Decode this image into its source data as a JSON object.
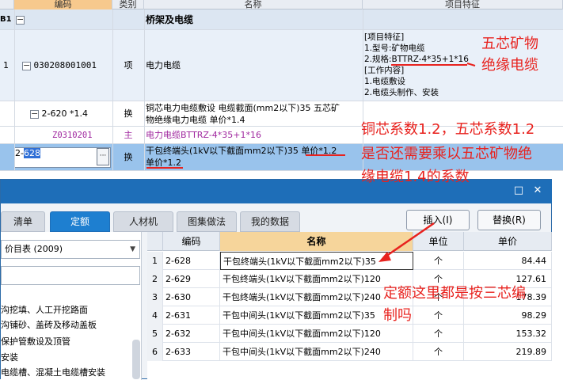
{
  "grid": {
    "headers": {
      "code": "编码",
      "type": "类别",
      "name": "名称",
      "feature": "项目特征"
    },
    "section": {
      "num": "B1",
      "toggle": "−",
      "name": "桥架及电缆"
    },
    "item": {
      "num": "1",
      "toggle": "−",
      "code": "030208001001",
      "type": "项",
      "name": "电力电缆",
      "features": [
        "[项目特征]",
        "1.型号:矿物电缆",
        "2.规格:BTTRZ-4*35+1*16",
        "[工作内容]",
        "1.电缆敷设",
        "2.电缆头制作、安装"
      ]
    },
    "sub": {
      "toggle": "−",
      "code": "2-620 *1.4",
      "type": "换",
      "name_line1": "铜芯电力电缆敷设 电缆截面(mm2以下)35  五芯矿",
      "name_line2": "物绝缘电力电缆 单价*1.4"
    },
    "main_material": {
      "code": "Z0310201",
      "type": "主",
      "name": "电力电缆BTTRZ-4*35+1*16"
    },
    "selected": {
      "code_prefix": "2-",
      "code_selected": "628",
      "more_button": "···",
      "type": "换",
      "name_line1": "干包终端头(1kV以下截面mm2以下)35  单价*1.2",
      "name_line2": "单价*1.2"
    }
  },
  "annotations": {
    "mineral_cable_line1": "五芯矿物",
    "mineral_cable_line2": "绝缘电缆",
    "question_line1": "铜芯系数1.2，五芯系数1.2",
    "question_line2": "是否还需要乘以五芯矿物绝",
    "question_line3": "缘电缆1.4的系数",
    "bottom_line1": "定额这里都是按三芯编",
    "bottom_line2": "制吗",
    "color": "#e8221e"
  },
  "dialog": {
    "title_buttons": {
      "maximize": "□",
      "close": "✕"
    },
    "tabs": [
      "清单",
      "定额",
      "人材机",
      "图集做法",
      "我的数据"
    ],
    "active_tab": "定额",
    "insert_button": "插入(I)",
    "replace_button": "替换(R)",
    "catalog_select": "价目表 (2009)",
    "tree_items": [
      "沟挖填、人工开挖路面",
      "沟铺砂、盖砖及移动盖板",
      "保护管敷设及顶管",
      "安装",
      "电缆槽、混凝土电缆槽安装"
    ],
    "table": {
      "columns": [
        "",
        "编码",
        "名称",
        "单位",
        "单价"
      ],
      "rows": [
        {
          "idx": "1",
          "code": "2-628",
          "name": "干包终端头(1kV以下截面mm2以下)35",
          "unit": "个",
          "price": "84.44"
        },
        {
          "idx": "2",
          "code": "2-629",
          "name": "干包终端头(1kV以下截面mm2以下)120",
          "unit": "个",
          "price": "127.61"
        },
        {
          "idx": "3",
          "code": "2-630",
          "name": "干包终端头(1kV以下截面mm2以下)240",
          "unit": "个",
          "price": "178.39"
        },
        {
          "idx": "4",
          "code": "2-631",
          "name": "干包中间头(1kV以下截面mm2以下)35",
          "unit": "个",
          "price": "98.29"
        },
        {
          "idx": "5",
          "code": "2-632",
          "name": "干包中间头(1kV以下截面mm2以下)120",
          "unit": "个",
          "price": "153.32"
        },
        {
          "idx": "6",
          "code": "2-633",
          "name": "干包中间头(1kV以下截面mm2以下)240",
          "unit": "个",
          "price": "219.89"
        }
      ]
    }
  }
}
